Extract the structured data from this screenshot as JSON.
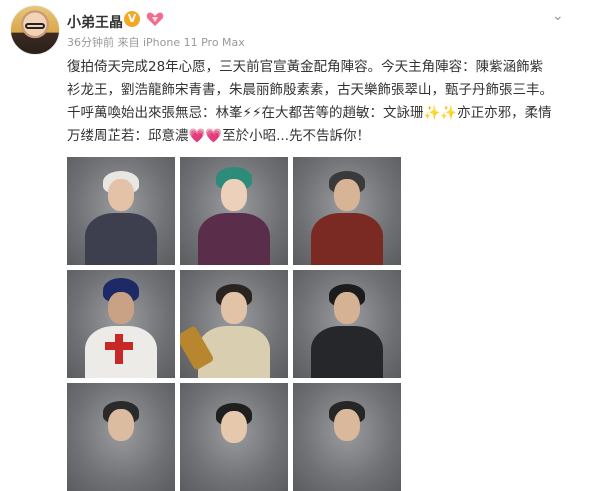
{
  "post": {
    "username": "小弟王晶",
    "verified_badge": "V",
    "vip_icon": "heart-vip-icon",
    "menu_icon": "chevron-down-icon",
    "meta": "36分钟前 来自 iPhone 11 Pro Max",
    "text": "復拍倚天完成28年心愿，三天前官宣黃金配角陣容。今天主角陣容：陳紫涵飾紫衫龙王，劉浩龍飾宋青書，朱晨丽飾殷素素，古天樂飾張翠山，甄子丹飾張三丰。千呼萬喚始出來張無忌：林峯⚡⚡在大都苦等的趙敏：文詠珊✨✨亦正亦邪，柔情万缕周芷若：邱意濃💗💗至於小昭...先不告訴你！"
  },
  "colors": {
    "text": "#333333",
    "meta": "#999999",
    "badge": "#f5a623",
    "vip": "#f56c8b",
    "photo_bg": "#6d6f72",
    "cross": "#c62828"
  },
  "photos": [
    {
      "name": "photo-elder-white-hair"
    },
    {
      "name": "photo-green-horned-headpiece"
    },
    {
      "name": "photo-grey-hair-elder"
    },
    {
      "name": "photo-white-robe-red-cross"
    },
    {
      "name": "photo-young-man-with-weapon"
    },
    {
      "name": "photo-dark-armor-warrior"
    },
    {
      "name": "photo-row3-left"
    },
    {
      "name": "photo-row3-middle"
    },
    {
      "name": "photo-row3-right"
    }
  ]
}
